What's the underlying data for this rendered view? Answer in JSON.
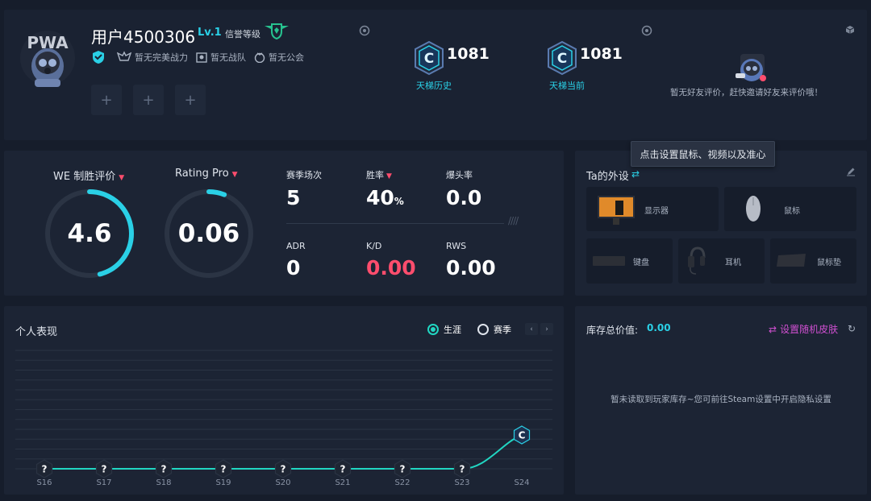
{
  "profile": {
    "username": "用户4500306",
    "level": "Lv.1",
    "credit_label": "信誉等级",
    "badges": [
      {
        "icon": "shield-check-icon",
        "label": ""
      },
      {
        "icon": "rank-wings-icon",
        "label": "暂无完美战力"
      },
      {
        "icon": "team-icon",
        "label": "暂无战队"
      },
      {
        "icon": "guild-icon",
        "label": "暂无公会"
      }
    ],
    "slot_plus": "+"
  },
  "ladder": [
    {
      "rank_letter": "C",
      "value": "1081",
      "label": "天梯历史"
    },
    {
      "rank_letter": "C",
      "value": "1081",
      "label": "天梯当前"
    }
  ],
  "friend_review": {
    "text": "暂无好友评价，赶快邀请好友来评价哦！"
  },
  "ratings": {
    "we": {
      "label": "WE 制胜评价",
      "value": "4.6",
      "fraction": 0.46
    },
    "pro": {
      "label": "Rating Pro",
      "value": "0.06",
      "fraction": 0.06
    }
  },
  "stats": {
    "matches": {
      "label": "赛季场次",
      "value": "5"
    },
    "winrate": {
      "label": "胜率",
      "value": "40",
      "unit": "%"
    },
    "headshot": {
      "label": "爆头率",
      "value": "0.0"
    },
    "adr": {
      "label": "ADR",
      "value": "0"
    },
    "kd": {
      "label": "K/D",
      "value": "0.00"
    },
    "rws": {
      "label": "RWS",
      "value": "0.00"
    },
    "hatch": "////"
  },
  "equipment": {
    "title": "Ta的外设",
    "tooltip": "点击设置鼠标、视频以及准心",
    "items": {
      "monitor": "显示器",
      "mouse": "鼠标",
      "keyboard": "键盘",
      "headset": "耳机",
      "mousepad": "鼠标垫"
    }
  },
  "performance": {
    "title": "个人表现",
    "mode_career": "生涯",
    "mode_season": "赛季",
    "prev": "‹",
    "next": "›"
  },
  "chart_data": {
    "type": "line",
    "categories": [
      "S16",
      "S17",
      "S18",
      "S19",
      "S20",
      "S21",
      "S22",
      "S23",
      "S24"
    ],
    "series": [
      {
        "markers": [
          "?",
          "?",
          "?",
          "?",
          "?",
          "?",
          "?",
          "?",
          "C"
        ],
        "values": [
          0,
          0,
          0,
          0,
          0,
          0,
          0,
          0,
          1
        ]
      }
    ],
    "ylim": [
      0,
      3.5
    ],
    "grid": true,
    "color": "#21d6c2"
  },
  "inventory": {
    "label": "库存总价值:",
    "value": "0.00",
    "skin_button": "设置随机皮肤",
    "empty_text": "暂未读取到玩家库存~您可前往Steam设置中开启隐私设置"
  },
  "colors": {
    "accent": "#2ad0e6",
    "red": "#ff4d6d",
    "teal": "#21d6c2",
    "magenta": "#cf4fd0"
  }
}
